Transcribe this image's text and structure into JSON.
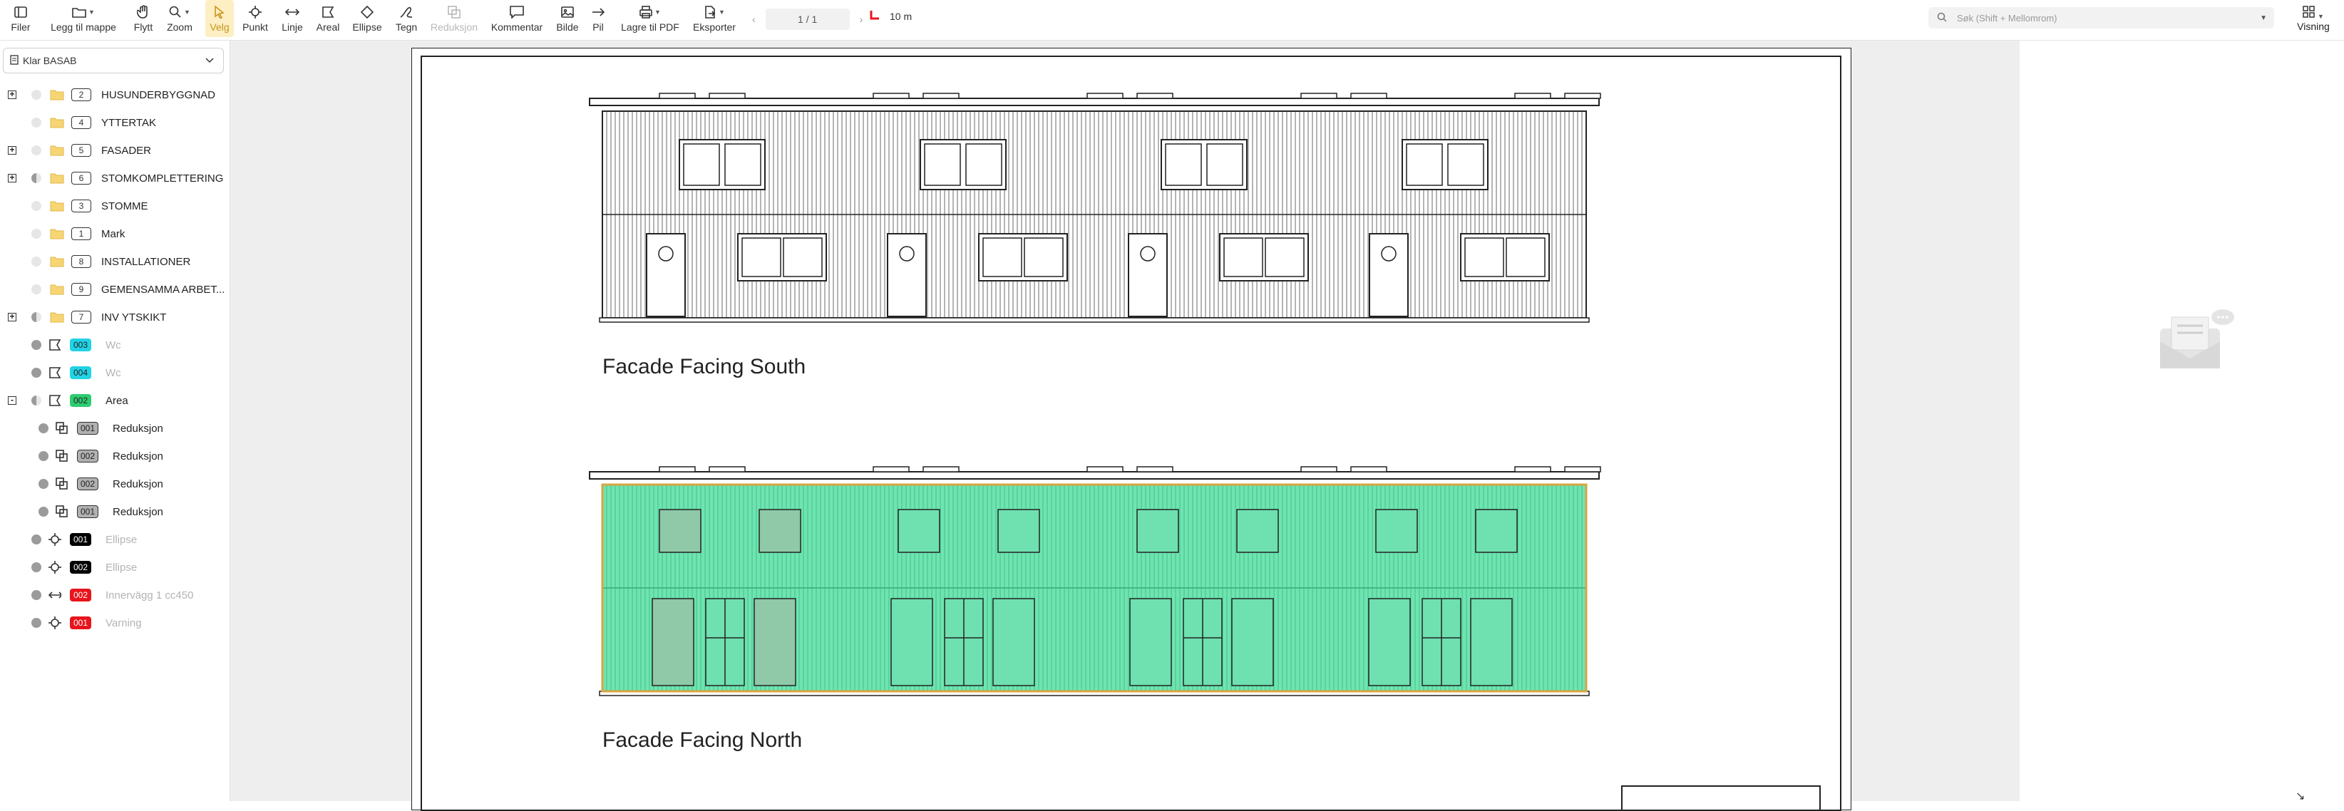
{
  "toolbar": {
    "files": "Filer",
    "add_to_folder": "Legg til mappe",
    "move": "Flytt",
    "zoom": "Zoom",
    "select": "Velg",
    "point": "Punkt",
    "line": "Linje",
    "area": "Areal",
    "ellipse": "Ellipse",
    "draw": "Tegn",
    "reduction": "Reduksjon",
    "comment": "Kommentar",
    "image": "Bilde",
    "arrow": "Pil",
    "save_pdf": "Lagre til PDF",
    "export": "Eksporter",
    "view": "Visning"
  },
  "pager": {
    "page": "1 / 1"
  },
  "scale": {
    "value": "10 m"
  },
  "search": {
    "placeholder": "Søk (Shift + Mellomrom)"
  },
  "project": {
    "name": "Klar BASAB"
  },
  "tree": [
    {
      "expander": "+",
      "dot": "light",
      "icon": "folder",
      "badge": "2",
      "label": "HUSUNDERBYGGNAD",
      "dim": false
    },
    {
      "expander": "",
      "dot": "light",
      "icon": "folder",
      "badge": "4",
      "label": "YTTERTAK",
      "dim": false
    },
    {
      "expander": "+",
      "dot": "light",
      "icon": "folder",
      "badge": "5",
      "label": "FASADER",
      "dim": false
    },
    {
      "expander": "+",
      "dot": "half",
      "icon": "folder",
      "badge": "6",
      "label": "STOMKOMPLETTERING",
      "dim": false
    },
    {
      "expander": "",
      "dot": "light",
      "icon": "folder",
      "badge": "3",
      "label": "STOMME",
      "dim": false
    },
    {
      "expander": "",
      "dot": "light",
      "icon": "folder",
      "badge": "1",
      "label": "Mark",
      "dim": false
    },
    {
      "expander": "",
      "dot": "light",
      "icon": "folder",
      "badge": "8",
      "label": "INSTALLATIONER",
      "dim": false
    },
    {
      "expander": "",
      "dot": "light",
      "icon": "folder",
      "badge": "9",
      "label": "GEMENSAMMA ARBET...",
      "dim": false
    },
    {
      "expander": "+",
      "dot": "half",
      "icon": "folder",
      "badge": "7",
      "label": "INV YTSKIKT",
      "dim": false
    },
    {
      "expander": "",
      "dot": "dark",
      "icon": "area",
      "badge": "003",
      "badge_color": "#22d3e6",
      "label": "Wc",
      "dim": true
    },
    {
      "expander": "",
      "dot": "dark",
      "icon": "area",
      "badge": "004",
      "badge_color": "#22d3e6",
      "label": "Wc",
      "dim": true
    },
    {
      "expander": "-",
      "dot": "half",
      "icon": "area",
      "badge": "002",
      "badge_color": "#2ecc71",
      "label": "Area",
      "dim": false
    },
    {
      "expander": "",
      "dot": "dark",
      "icon": "reduction",
      "badge": "001",
      "badge_color": "#b0b0b0",
      "label": "Reduksjon",
      "dim": false,
      "indent": true
    },
    {
      "expander": "",
      "dot": "dark",
      "icon": "reduction",
      "badge": "002",
      "badge_color": "#b0b0b0",
      "label": "Reduksjon",
      "dim": false,
      "indent": true
    },
    {
      "expander": "",
      "dot": "dark",
      "icon": "reduction",
      "badge": "002",
      "badge_color": "#b0b0b0",
      "label": "Reduksjon",
      "dim": false,
      "indent": true
    },
    {
      "expander": "",
      "dot": "dark",
      "icon": "reduction",
      "badge": "001",
      "badge_color": "#b0b0b0",
      "label": "Reduksjon",
      "dim": false,
      "indent": true
    },
    {
      "expander": "",
      "dot": "dark",
      "icon": "point",
      "badge": "001",
      "badge_color": "#000000",
      "label": "Ellipse",
      "dim": true
    },
    {
      "expander": "",
      "dot": "dark",
      "icon": "point",
      "badge": "002",
      "badge_color": "#000000",
      "label": "Ellipse",
      "dim": true
    },
    {
      "expander": "",
      "dot": "dark",
      "icon": "line",
      "badge": "002",
      "badge_color": "#e8141c",
      "label": "Innervägg 1 cc450",
      "dim": true
    },
    {
      "expander": "",
      "dot": "dark",
      "icon": "point",
      "badge": "001",
      "badge_color": "#e8141c",
      "label": "Varning",
      "dim": true
    }
  ],
  "drawing": {
    "south_title": "Facade Facing South",
    "north_title": "Facade Facing North",
    "area_fill": "#3ddc97",
    "area_fill_opacity": 0.75,
    "area_border": "#d9a441"
  },
  "colors": {
    "accent": "#fdeec3",
    "active_tool": "#c8961a"
  }
}
